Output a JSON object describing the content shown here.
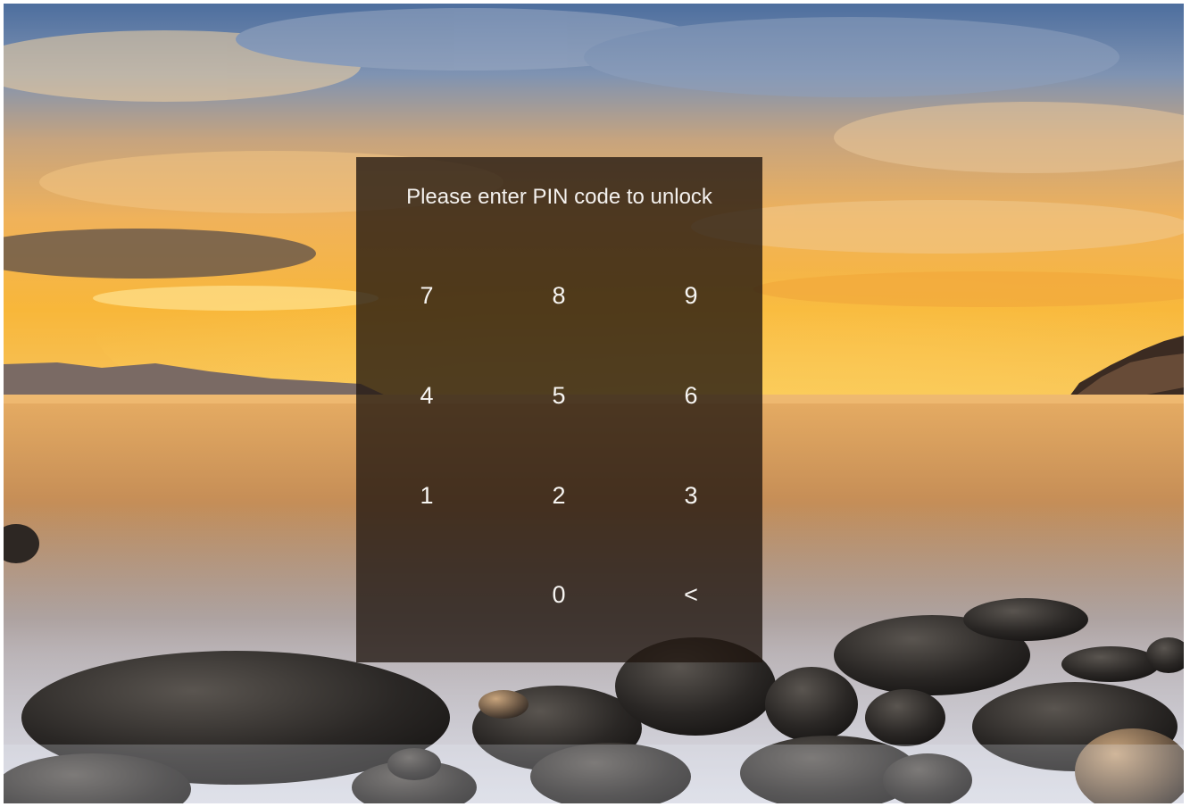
{
  "lock_screen": {
    "prompt": "Please enter PIN code to unlock",
    "wallpaper": "sunset-sea-rocks-photo",
    "colors": {
      "panel": "#201610",
      "text": "#f4f1ee",
      "sky_top": "#5d7aa6",
      "sky_glow": "#f5a93c",
      "sea": "#c98f55"
    }
  },
  "keypad": {
    "keys": [
      {
        "label": "7",
        "name": "key-7"
      },
      {
        "label": "8",
        "name": "key-8"
      },
      {
        "label": "9",
        "name": "key-9"
      },
      {
        "label": "4",
        "name": "key-4"
      },
      {
        "label": "5",
        "name": "key-5"
      },
      {
        "label": "6",
        "name": "key-6"
      },
      {
        "label": "1",
        "name": "key-1"
      },
      {
        "label": "2",
        "name": "key-2"
      },
      {
        "label": "3",
        "name": "key-3"
      },
      {
        "label": "0",
        "name": "key-0"
      },
      {
        "label": "<",
        "name": "backspace-key"
      }
    ]
  }
}
